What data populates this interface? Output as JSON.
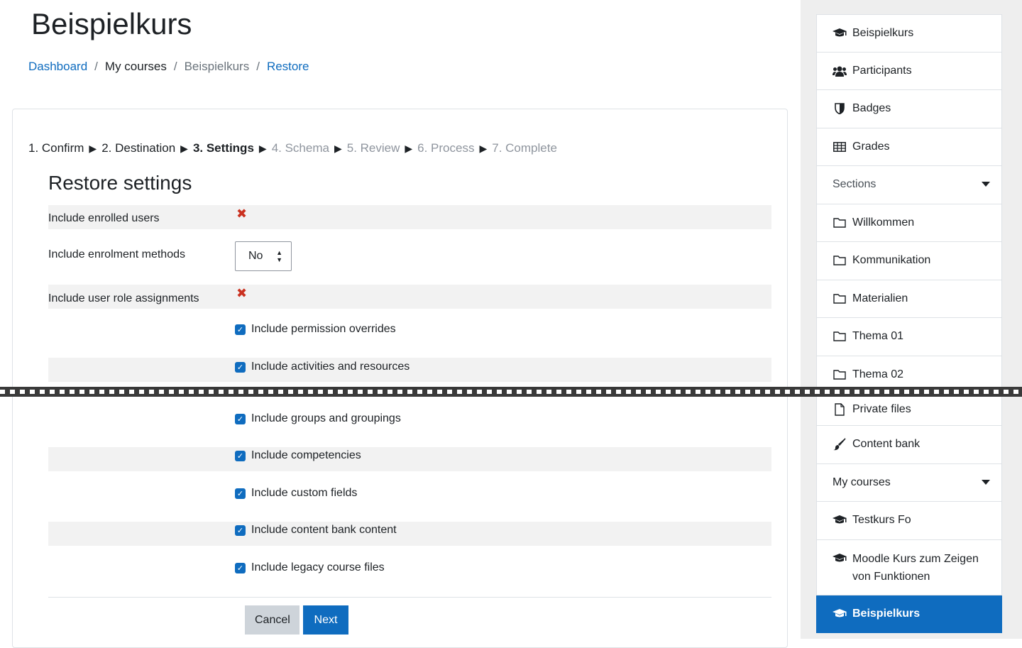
{
  "page": {
    "title": "Beispielkurs"
  },
  "breadcrumb": [
    {
      "label": "Dashboard"
    },
    {
      "label": "My courses"
    },
    {
      "label": "Beispielkurs"
    },
    {
      "label": "Restore"
    }
  ],
  "steps": {
    "s1": "1. Confirm",
    "s2": "2. Destination",
    "s3": "3. Settings",
    "s4": "4. Schema",
    "s5": "5. Review",
    "s6": "6. Process",
    "s7": "7. Complete",
    "current": "3. Settings"
  },
  "settings": {
    "title": "Restore settings",
    "enrolled_users_label": "Include enrolled users",
    "enrolment_methods_label": "Include enrolment methods",
    "enrolment_methods_value": "No",
    "role_assignments_label": "Include user role assignments",
    "checkboxes": [
      {
        "label": "Include permission overrides",
        "checked": true
      },
      {
        "label": "Include activities and resources",
        "checked": true
      },
      {
        "label": "Include groups and groupings",
        "checked": true
      },
      {
        "label": "Include competencies",
        "checked": true
      },
      {
        "label": "Include custom fields",
        "checked": true
      },
      {
        "label": "Include content bank content",
        "checked": true
      },
      {
        "label": "Include legacy course files",
        "checked": true
      }
    ],
    "cancel_label": "Cancel",
    "next_label": "Next"
  },
  "sidebar": {
    "items": [
      {
        "label": "Beispielkurs",
        "icon": "graduation-cap-icon"
      },
      {
        "label": "Participants",
        "icon": "users-icon"
      },
      {
        "label": "Badges",
        "icon": "shield-icon"
      },
      {
        "label": "Grades",
        "icon": "table-icon"
      },
      {
        "label": "Sections",
        "icon": "caret-down-icon"
      },
      {
        "label": "Willkommen",
        "icon": "folder-icon"
      },
      {
        "label": "Kommunikation",
        "icon": "folder-icon"
      },
      {
        "label": "Materialien",
        "icon": "folder-icon"
      },
      {
        "label": "Thema 01",
        "icon": "folder-icon"
      },
      {
        "label": "Thema 02",
        "icon": "folder-icon"
      },
      {
        "label": "Private files",
        "icon": "file-icon"
      },
      {
        "label": "Content bank",
        "icon": "paintbrush-icon"
      },
      {
        "label": "My courses",
        "icon": "caret-down-icon"
      },
      {
        "label": "Testkurs Fo",
        "icon": "graduation-cap-icon"
      },
      {
        "label": "Moodle Kurs zum Zeigen von Funktionen",
        "icon": "graduation-cap-icon"
      },
      {
        "label": "Beispielkurs",
        "icon": "graduation-cap-icon",
        "active": true
      }
    ]
  },
  "colors": {
    "accent": "#0f6cbf",
    "error": "#ca3120",
    "sidebar_bg": "#eeeeee"
  }
}
